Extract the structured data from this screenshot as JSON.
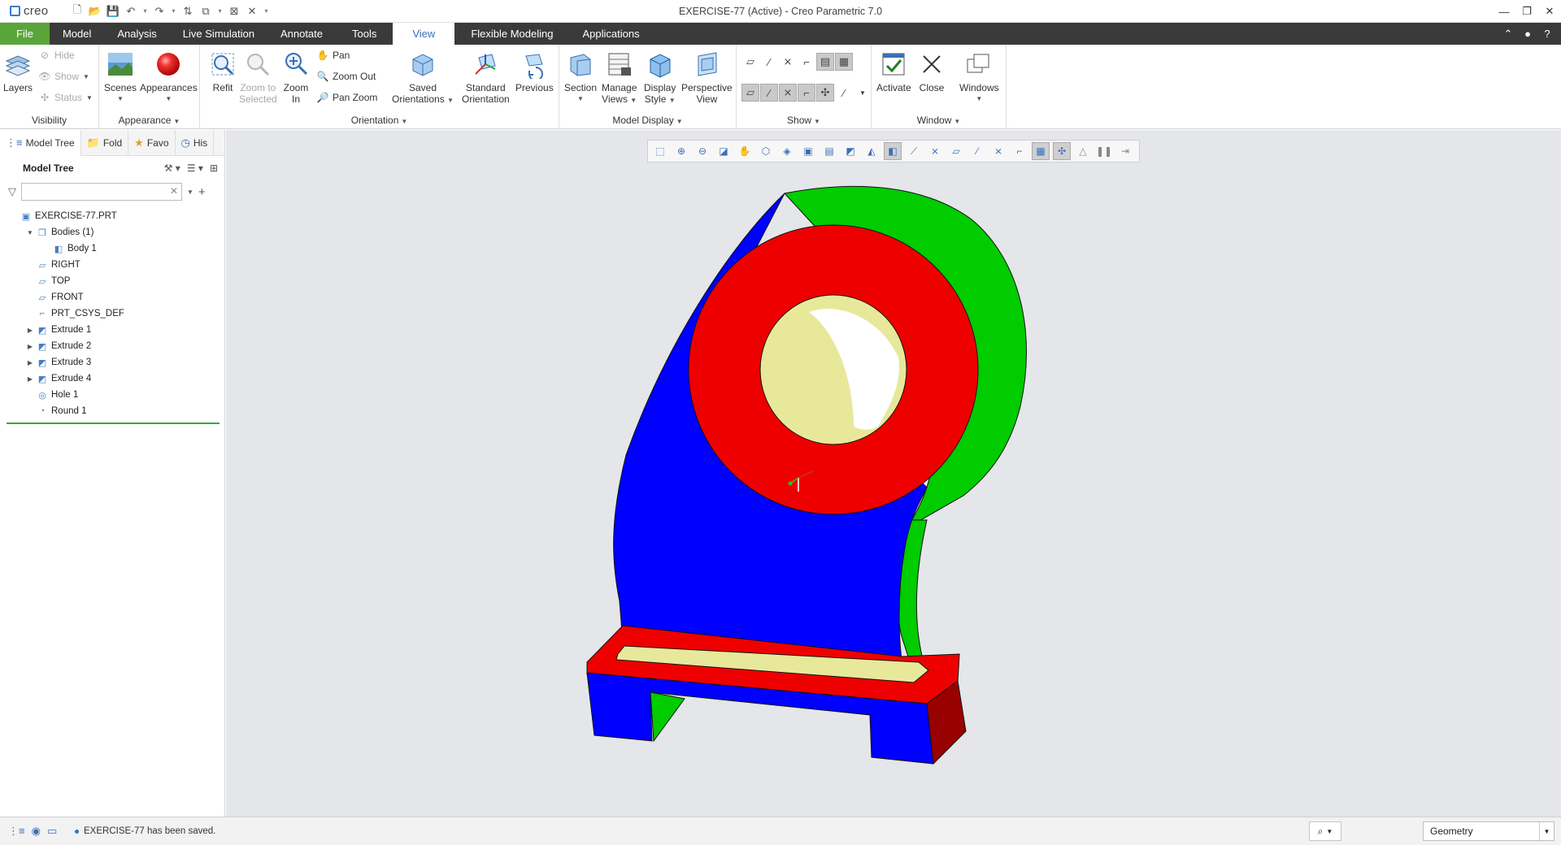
{
  "app": {
    "brand": "creo",
    "window_title": "EXERCISE-77 (Active) - Creo Parametric 7.0"
  },
  "ribbon_tabs": [
    "File",
    "Model",
    "Analysis",
    "Live Simulation",
    "Annotate",
    "Tools",
    "View",
    "Flexible Modeling",
    "Applications"
  ],
  "active_tab": "View",
  "ribbon": {
    "visibility": {
      "label": "Visibility",
      "layers": "Layers",
      "hide": "Hide",
      "show": "Show",
      "status": "Status"
    },
    "appearance": {
      "label": "Appearance",
      "scenes": "Scenes",
      "appearances": "Appearances"
    },
    "orientation": {
      "label": "Orientation",
      "refit": "Refit",
      "zoom_to_selected_1": "Zoom to",
      "zoom_to_selected_2": "Selected",
      "zoom_in_1": "Zoom",
      "zoom_in_2": "In",
      "pan": "Pan",
      "zoom_out": "Zoom Out",
      "pan_zoom": "Pan Zoom",
      "saved_1": "Saved",
      "saved_2": "Orientations",
      "standard_1": "Standard",
      "standard_2": "Orientation",
      "previous": "Previous"
    },
    "model_display": {
      "label": "Model Display",
      "section": "Section",
      "manage_1": "Manage",
      "manage_2": "Views",
      "display_1": "Display",
      "display_2": "Style",
      "perspective_1": "Perspective",
      "perspective_2": "View"
    },
    "show": {
      "label": "Show"
    },
    "window": {
      "label": "Window",
      "activate": "Activate",
      "close": "Close",
      "windows": "Windows"
    }
  },
  "left_panel": {
    "tabs": [
      "Model Tree",
      "Fold",
      "Favo",
      "His"
    ],
    "header": "Model Tree",
    "search_placeholder": "",
    "tree": [
      {
        "label": "EXERCISE-77.PRT",
        "indent": 0,
        "expander": "",
        "icon": "part-icon"
      },
      {
        "label": "Bodies (1)",
        "indent": 1,
        "expander": "▼",
        "icon": "bodies-icon"
      },
      {
        "label": "Body 1",
        "indent": 2,
        "expander": "",
        "icon": "body-icon"
      },
      {
        "label": "RIGHT",
        "indent": 1,
        "expander": "",
        "icon": "datum-plane-icon"
      },
      {
        "label": "TOP",
        "indent": 1,
        "expander": "",
        "icon": "datum-plane-icon"
      },
      {
        "label": "FRONT",
        "indent": 1,
        "expander": "",
        "icon": "datum-plane-icon"
      },
      {
        "label": "PRT_CSYS_DEF",
        "indent": 1,
        "expander": "",
        "icon": "csys-icon"
      },
      {
        "label": "Extrude 1",
        "indent": 1,
        "expander": "▶",
        "icon": "extrude-icon"
      },
      {
        "label": "Extrude 2",
        "indent": 1,
        "expander": "▶",
        "icon": "extrude-icon"
      },
      {
        "label": "Extrude 3",
        "indent": 1,
        "expander": "▶",
        "icon": "extrude-icon"
      },
      {
        "label": "Extrude 4",
        "indent": 1,
        "expander": "▶",
        "icon": "extrude-icon"
      },
      {
        "label": "Hole 1",
        "indent": 1,
        "expander": "",
        "icon": "hole-icon"
      },
      {
        "label": "Round 1",
        "indent": 1,
        "expander": "",
        "icon": "round-icon"
      }
    ]
  },
  "model_colors": {
    "body": "#0000ff",
    "side": "#00cc00",
    "boss_face": "#ee0000",
    "hole": "#e8e89a",
    "base_side": "#990000"
  },
  "status": {
    "message": "EXERCISE-77 has been saved.",
    "filter": "Geometry"
  }
}
